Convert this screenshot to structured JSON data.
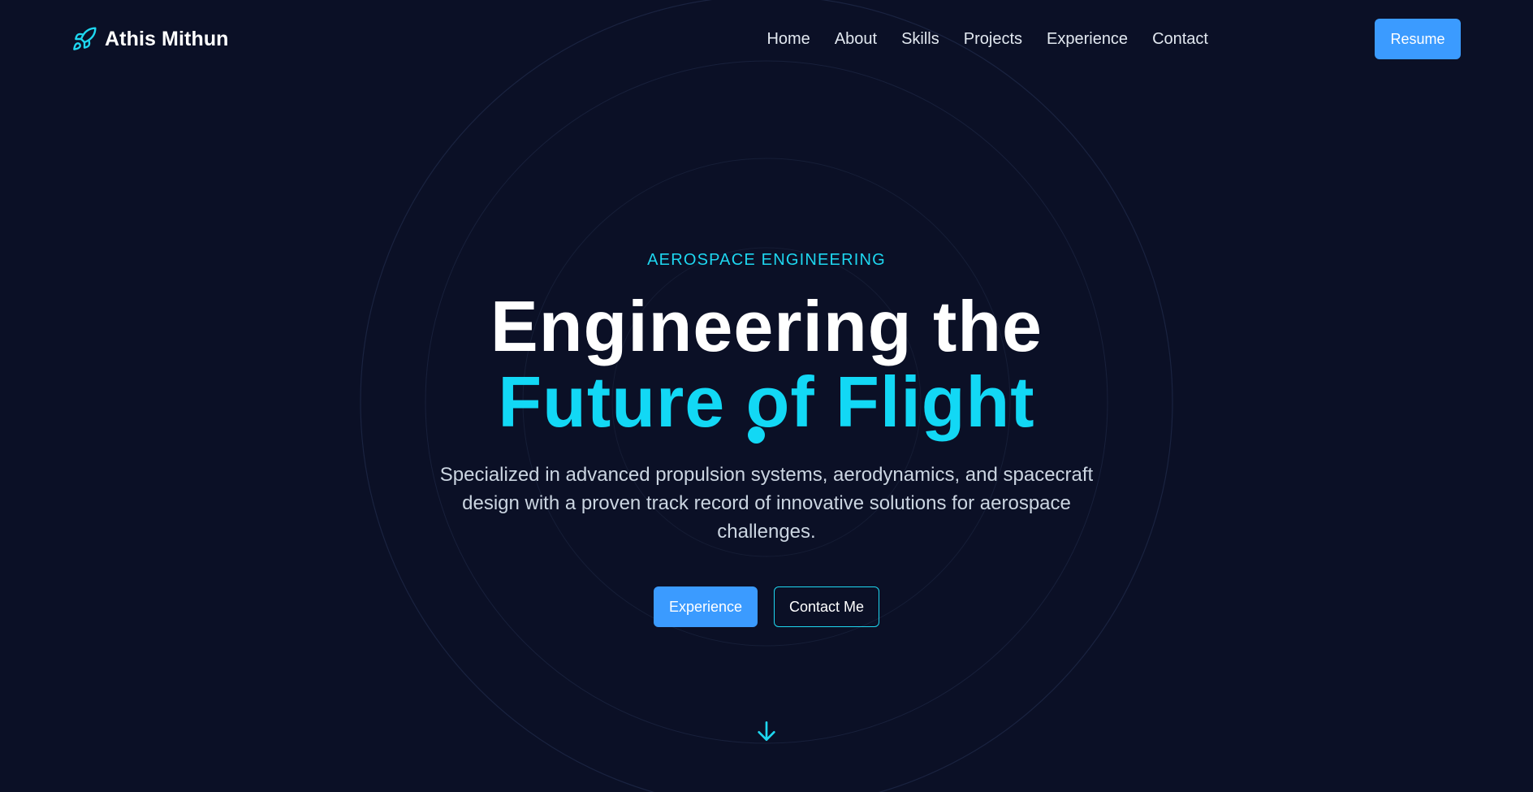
{
  "header": {
    "brand_name": "Athis Mithun",
    "brand_icon": "rocket-icon",
    "nav": [
      {
        "label": "Home"
      },
      {
        "label": "About"
      },
      {
        "label": "Skills"
      },
      {
        "label": "Projects"
      },
      {
        "label": "Experience"
      },
      {
        "label": "Contact"
      }
    ],
    "resume_label": "Resume"
  },
  "hero": {
    "eyebrow": "AEROSPACE ENGINEERING",
    "headline_line1": "Engineering the",
    "headline_line2": "Future of Flight",
    "subtitle": "Specialized in advanced propulsion systems, aerodynamics, and spacecraft design with a proven track record of innovative solutions for aerospace challenges.",
    "primary_cta": "Experience",
    "secondary_cta": "Contact Me",
    "scroll_icon": "arrow-down-icon"
  },
  "colors": {
    "background": "#0b1026",
    "accent_cyan": "#12d8f5",
    "accent_blue": "#3b9bff",
    "text_primary": "#ffffff",
    "text_muted": "#cbd5e1"
  }
}
